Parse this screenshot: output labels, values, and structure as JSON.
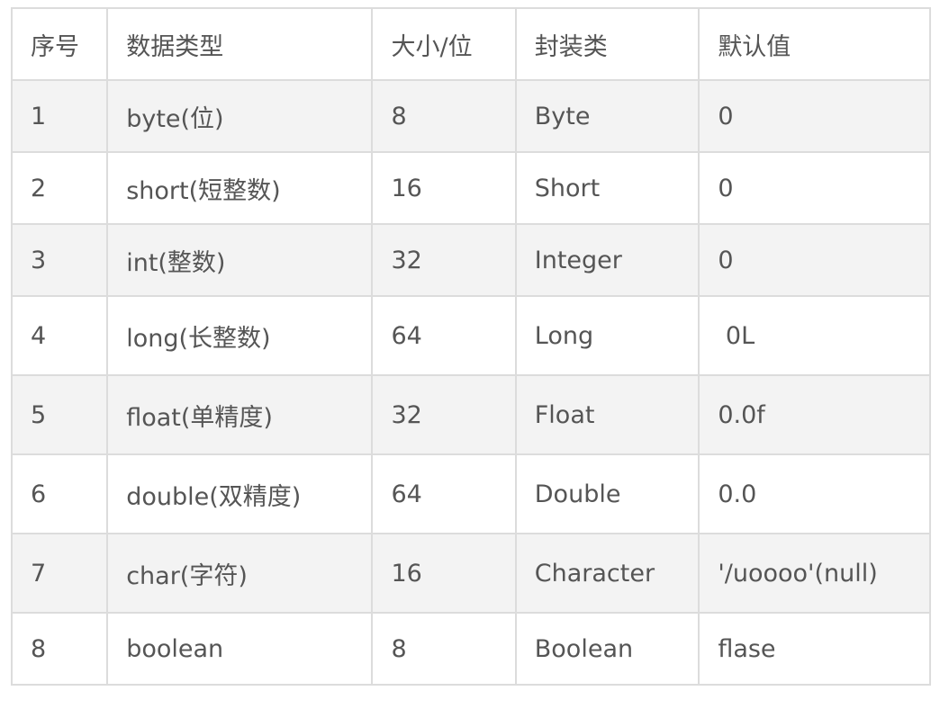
{
  "header": {
    "col1": "序号",
    "col2": "数据类型",
    "col3": "大小/位",
    "col4": "封装类",
    "col5": "默认值"
  },
  "rows": [
    {
      "no": "1",
      "type": "byte(位)",
      "size": "8",
      "wrapper": "Byte",
      "default": "0"
    },
    {
      "no": "2",
      "type": "short(短整数)",
      "size": "16",
      "wrapper": "Short",
      "default": "0"
    },
    {
      "no": "3",
      "type": "int(整数)",
      "size": "32",
      "wrapper": "Integer",
      "default": "0"
    },
    {
      "no": "4",
      "type": "long(长整数)",
      "size": "64",
      "wrapper": "Long",
      "default": " 0L"
    },
    {
      "no": "5",
      "type": "float(单精度)",
      "size": "32",
      "wrapper": "Float",
      "default": "0.0f"
    },
    {
      "no": "6",
      "type": "double(双精度)",
      "size": "64",
      "wrapper": "Double",
      "default": "0.0"
    },
    {
      "no": "7",
      "type": "char(字符)",
      "size": "16",
      "wrapper": "Character",
      "default": "'/uoooo'(null)"
    },
    {
      "no": "8",
      "type": "boolean",
      "size": "8",
      "wrapper": "Boolean",
      "default": "flase"
    }
  ]
}
